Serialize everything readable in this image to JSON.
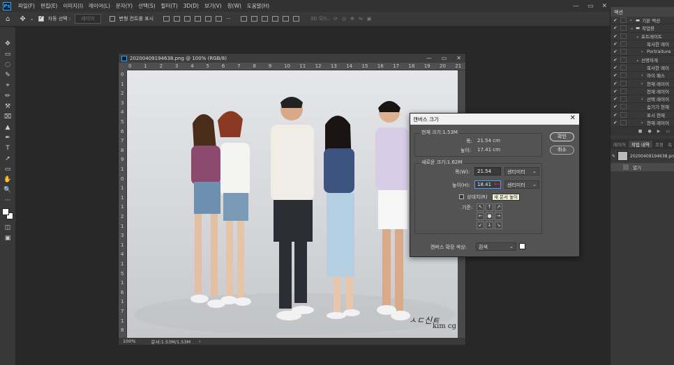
{
  "app": {
    "logo": "Ps"
  },
  "menu": [
    "파일(F)",
    "편집(E)",
    "이미지(I)",
    "레이어(L)",
    "문자(Y)",
    "선택(S)",
    "필터(T)",
    "3D(D)",
    "보기(V)",
    "창(W)",
    "도움말(H)"
  ],
  "window_controls": {
    "minimize": "—",
    "restore": "▭",
    "close": "✕"
  },
  "options": {
    "auto_select_label": "자동 선택 :",
    "auto_select_value": "레이어",
    "show_transform_label": "변형 컨트롤 표시",
    "mode_3d_label": "3D 모드:",
    "more": "···"
  },
  "tools": [
    "✥",
    "▭",
    "◌",
    "✎",
    "⌖",
    "✏",
    "⚒",
    "⌧",
    "▲",
    "✒",
    "T",
    "➚",
    "▭",
    "✋",
    "🔍",
    "···"
  ],
  "document": {
    "title": "20200409194638.png @ 100% (RGB/8)",
    "zoom": "100%",
    "doc_info": "문서:1.53M/1.53M",
    "ruler_h": [
      "0",
      "1",
      "2",
      "3",
      "4",
      "5",
      "6",
      "7",
      "8",
      "9",
      "10",
      "11",
      "12",
      "13",
      "14",
      "15",
      "16",
      "17",
      "18",
      "19",
      "20",
      "21"
    ],
    "ruler_v": [
      "0",
      "1",
      "2",
      "3",
      "4",
      "5",
      "6",
      "7",
      "8",
      "9",
      "1",
      "0",
      "1",
      "1",
      "1",
      "2",
      "1",
      "3",
      "1",
      "4",
      "1",
      "5",
      "1",
      "6",
      "1",
      "7",
      "1",
      "8"
    ],
    "watermark_sig": "ㅅㄷ신ㅌ",
    "watermark_text": "kim cg"
  },
  "dialog": {
    "title": "캔버스 크기",
    "close": "✕",
    "current_size_label": "현재 크기:1.53M",
    "width_label": "폭:",
    "width_value": "21.54 cm",
    "height_label": "높이:",
    "height_value": "17.41 cm",
    "new_size_label": "새로운 크기:1.62M",
    "new_width_label": "폭(W):",
    "new_width_value": "21.54",
    "new_height_label": "높이(H):",
    "new_height_value": "18.41",
    "unit_width": "센티미터",
    "unit_height": "센티미터",
    "relative_label": "상대치(R)",
    "tooltip": "새 문서 높이",
    "anchor_label": "기준:",
    "anchor": [
      "↖",
      "↑",
      "↗",
      "←",
      "●",
      "→",
      "↙",
      "↓",
      "↘"
    ],
    "extension_color_label": "캔버스 확장 색상:",
    "extension_color_value": "흰색",
    "ok": "확인",
    "cancel": "취소"
  },
  "right_panel": {
    "actions_tab": "액션",
    "actions": [
      {
        "indent": 1,
        "arrow": "›",
        "folder": true,
        "label": "기본 액션"
      },
      {
        "indent": 1,
        "arrow": "⌄",
        "folder": true,
        "label": "작업용"
      },
      {
        "indent": 2,
        "arrow": "⌄",
        "folder": false,
        "label": "포트레이트"
      },
      {
        "indent": 3,
        "arrow": "",
        "folder": false,
        "label": "복사한 레이"
      },
      {
        "indent": 3,
        "arrow": "›",
        "folder": false,
        "label": "Portraiture"
      },
      {
        "indent": 2,
        "arrow": "⌄",
        "folder": false,
        "label": "선명하게"
      },
      {
        "indent": 3,
        "arrow": "",
        "folder": false,
        "label": "복사한 레이"
      },
      {
        "indent": 3,
        "arrow": "›",
        "folder": false,
        "label": "하이 패스"
      },
      {
        "indent": 3,
        "arrow": "›",
        "folder": false,
        "label": "현재 레이어"
      },
      {
        "indent": 3,
        "arrow": "",
        "folder": false,
        "label": "현재 레이어"
      },
      {
        "indent": 3,
        "arrow": "›",
        "folder": false,
        "label": "선택 레이어"
      },
      {
        "indent": 3,
        "arrow": "",
        "folder": false,
        "label": "숨기기 현재"
      },
      {
        "indent": 3,
        "arrow": "",
        "folder": false,
        "label": "표시 현재"
      },
      {
        "indent": 3,
        "arrow": "›",
        "folder": false,
        "label": "현재 레이어"
      }
    ],
    "bottom_tabs": [
      "레이어",
      "작업 내역",
      "조정",
      "속"
    ],
    "history_snapshot": "20200409194638.pn",
    "history_item": "열기"
  },
  "colors": {
    "accent": "#31a8ff",
    "dialog_bg": "#535353",
    "panel_bg": "#383838"
  }
}
